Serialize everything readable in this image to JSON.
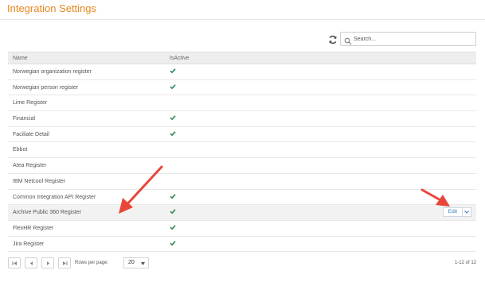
{
  "header": {
    "title": "Integration Settings"
  },
  "toolbar": {
    "search_placeholder": "Search..."
  },
  "table": {
    "columns": [
      "Name",
      "IsActive"
    ],
    "rows": [
      {
        "name": "Norwegian organization register",
        "is_active": true
      },
      {
        "name": "Norwegian person register",
        "is_active": true
      },
      {
        "name": "Lime Register",
        "is_active": false
      },
      {
        "name": "Financial",
        "is_active": true
      },
      {
        "name": "Faciliate Detail",
        "is_active": true
      },
      {
        "name": "Ebbot",
        "is_active": false
      },
      {
        "name": "Atea Register",
        "is_active": false
      },
      {
        "name": "IBM Netcool Register",
        "is_active": false
      },
      {
        "name": "Common Integration API Register",
        "is_active": true
      },
      {
        "name": "Archive Public 360 Register",
        "is_active": true,
        "highlighted": true,
        "edit_label": "Edit"
      },
      {
        "name": "FlexHR Register",
        "is_active": true
      },
      {
        "name": "Jira Register",
        "is_active": true
      }
    ]
  },
  "pager": {
    "rows_per_page_label": "Rows per page:",
    "rows_per_page_value": "20",
    "page_info": "1-12 of 12"
  },
  "colors": {
    "title": "#e8861d",
    "check": "#2e8b57",
    "annotation_arrow": "#e8463a",
    "edit_text": "#2f7ab9"
  }
}
